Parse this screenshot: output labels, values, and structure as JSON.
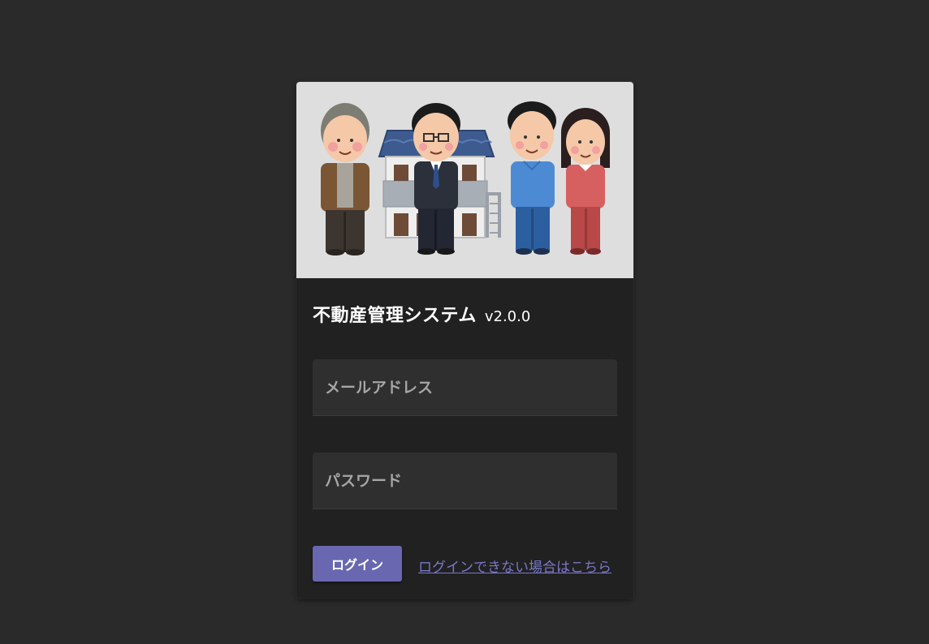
{
  "app": {
    "title": "不動産管理システム",
    "version": "v2.0.0"
  },
  "hero": {
    "icon": "people-house-illustration"
  },
  "form": {
    "email_placeholder": "メールアドレス",
    "password_placeholder": "パスワード",
    "login_label": "ログイン",
    "help_link": "ログインできない場合はこちら"
  },
  "colors": {
    "background": "#2a2a2a",
    "card": "#212121",
    "accent": "#6a67b1",
    "link": "#7a78c9"
  }
}
